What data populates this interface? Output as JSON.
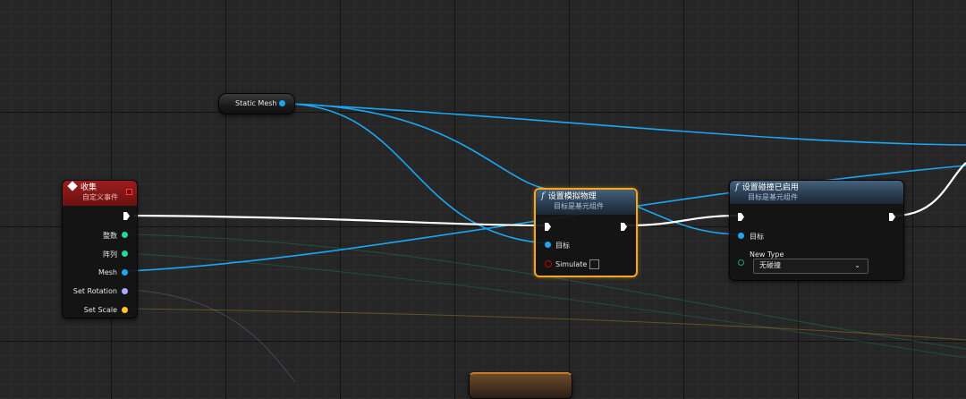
{
  "static_mesh_node": {
    "label": "Static Mesh"
  },
  "event_node": {
    "title": "收集",
    "subtitle": "自定义事件",
    "pins": [
      {
        "label": "整数",
        "type": "integer",
        "color": "#1ed9a2"
      },
      {
        "label": "阵列",
        "type": "integer-array",
        "color": "#1ed9a2"
      },
      {
        "label": "Mesh",
        "type": "object",
        "color": "#1ba7f5"
      },
      {
        "label": "Set Rotation",
        "type": "rotator",
        "color": "#a9a9ff"
      },
      {
        "label": "Set Scale",
        "type": "vector",
        "color": "#ffca28"
      }
    ]
  },
  "simulate_node": {
    "icon": "function-icon",
    "title": "设置模拟物理",
    "subtitle": "目标是基元组件",
    "target_label": "目标",
    "simulate_label": "Simulate",
    "simulate_checked": false,
    "selected": true
  },
  "collision_node": {
    "icon": "function-icon",
    "title": "设置碰撞已启用",
    "subtitle": "目标是基元组件",
    "target_label": "目标",
    "new_type_label": "New Type",
    "new_type_value": "无碰撞"
  },
  "colors": {
    "exec_wire": "#ffffff",
    "object_wire": "#1ba7f5",
    "event_header": "#8b1a1a",
    "function_header": "#3a5068",
    "selection": "#f5a623"
  }
}
